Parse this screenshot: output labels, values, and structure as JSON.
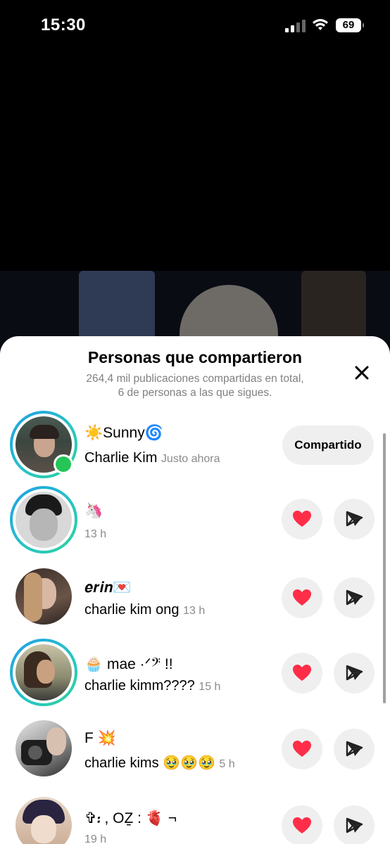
{
  "status_bar": {
    "time": "15:30",
    "battery": "69"
  },
  "sheet": {
    "title": "Personas que compartieron",
    "subtitle": "264,4 mil publicaciones compartidas en total, 6 de personas a las que sigues."
  },
  "rows": [
    {
      "name": "☀️Sunny🌀",
      "subtitle": "Charlie Kim",
      "time": "Justo ahora",
      "action": "Compartido",
      "story_ring": true,
      "online": true
    },
    {
      "name": "🦄",
      "subtitle": "",
      "time": "13 h",
      "story_ring": true
    },
    {
      "name": "𝒆𝒓𝒊𝒏💌",
      "subtitle": "charlie kim ong",
      "time": "13 h",
      "story_ring": false
    },
    {
      "name": "🧁 mae ·ᐟ𝄢 !!",
      "subtitle": "charlie kimm????",
      "time": "15 h",
      "story_ring": true
    },
    {
      "name": "F 💥",
      "subtitle": "charlie kims 🥹🥹🥹",
      "time": "5 h",
      "story_ring": false
    },
    {
      "name": "✞᎓ , OẔ : 🫀 ¬",
      "subtitle": "",
      "time": "19 h",
      "story_ring": false
    }
  ],
  "icons": {
    "like": "heart-icon",
    "send": "send-icon",
    "close": "close-icon"
  },
  "colors": {
    "heart": "#ff2d48",
    "online": "#25c558",
    "ring_start": "#1e9ee8",
    "ring_end": "#2fd39a"
  }
}
